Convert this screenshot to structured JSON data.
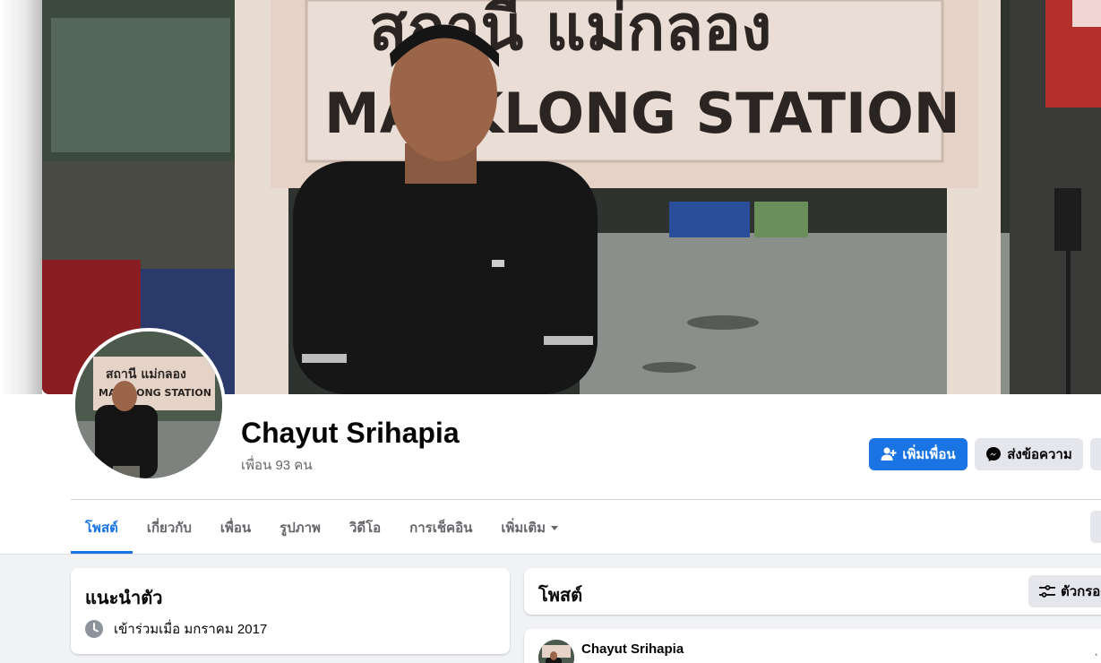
{
  "profile": {
    "name": "Chayut Srihapia",
    "friends": "เพื่อน 93 คน"
  },
  "cover_photo": {
    "sign_line1": "สถานี แม่กลอง",
    "sign_line2": "MAEKLONG STATION"
  },
  "avatar_photo": {
    "sign_line1": "สถานี แม่กลอง",
    "sign_line2": "MAEKLONG STATION"
  },
  "actions": {
    "add_friend": "เพิ่มเพื่อน",
    "message": "ส่งข้อความ"
  },
  "tabs": [
    {
      "label": "โพสต์",
      "active": true
    },
    {
      "label": "เกี่ยวกับ",
      "active": false
    },
    {
      "label": "เพื่อน",
      "active": false
    },
    {
      "label": "รูปภาพ",
      "active": false
    },
    {
      "label": "วิดีโอ",
      "active": false
    },
    {
      "label": "การเช็คอิน",
      "active": false
    },
    {
      "label": "เพิ่มเติม",
      "active": false
    }
  ],
  "intro": {
    "title": "แนะนำตัว",
    "joined": "เข้าร่วมเมื่อ มกราคม 2017"
  },
  "posts": {
    "title": "โพสต์",
    "filter_label": "ตัวกรอง",
    "first_post_author": "Chayut Srihapia"
  },
  "colors": {
    "primary": "#1b74e4",
    "secondary_button": "#e4e6eb",
    "page_background": "#f0f2f5",
    "muted_text": "#65676b"
  }
}
